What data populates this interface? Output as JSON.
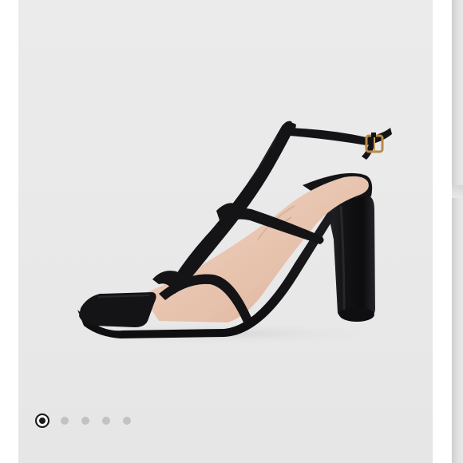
{
  "carousel": {
    "image_icon": "product-photo-sandal",
    "total_slides": 5,
    "active_index": 0,
    "indicators": [
      {
        "state": "active"
      },
      {
        "state": "inactive"
      },
      {
        "state": "inactive"
      },
      {
        "state": "inactive"
      },
      {
        "state": "inactive"
      }
    ]
  },
  "colors": {
    "background": "#ffffff",
    "slide_background": "#e9e9e9",
    "leather": "#141417",
    "insole": "#e9c8b4",
    "dot_active": "#1a1a1a",
    "dot_inactive": "#c2c2c2"
  }
}
